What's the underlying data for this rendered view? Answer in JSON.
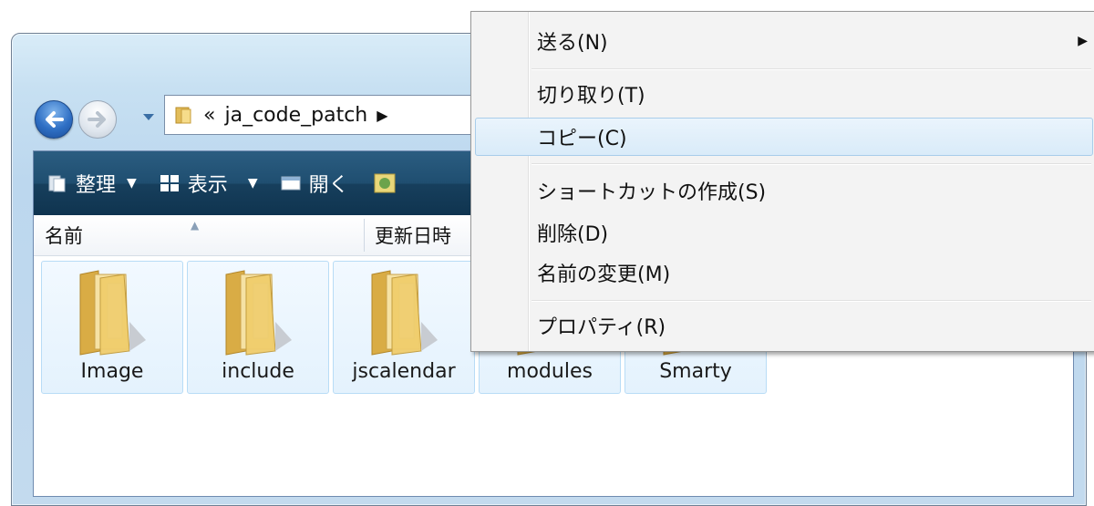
{
  "address": {
    "prefix": "«",
    "crumb": "ja_code_patch"
  },
  "toolbar": {
    "organize_label": "整理",
    "view_label": "表示",
    "open_label": "開く"
  },
  "columns": {
    "name": "名前",
    "date_modified": "更新日時"
  },
  "folders": [
    {
      "label": "Image"
    },
    {
      "label": "include"
    },
    {
      "label": "jscalendar"
    },
    {
      "label": "modules"
    },
    {
      "label": "Smarty"
    }
  ],
  "context_menu": {
    "send_to": "送る(N)",
    "cut": "切り取り(T)",
    "copy": "コピー(C)",
    "create_shortcut": "ショートカットの作成(S)",
    "delete": "削除(D)",
    "rename": "名前の変更(M)",
    "properties": "プロパティ(R)"
  },
  "colors": {
    "toolbar_bg": "#1f4e70",
    "menu_hover": "#d9ebf9",
    "tile_bg": "#e4f2fd"
  }
}
